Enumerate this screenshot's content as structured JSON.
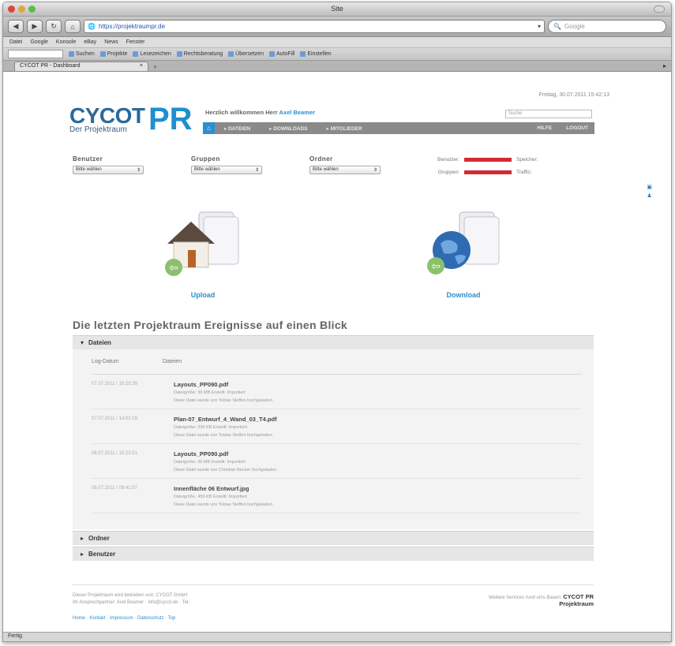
{
  "window": {
    "title": "Site"
  },
  "toolbar": {
    "back": "◀",
    "forward": "▶",
    "reload": "↻",
    "home": "⌂",
    "url": "https://projektraumpr.de",
    "url_icon": "globe-icon",
    "search_placeholder": "Google"
  },
  "menubar": {
    "items": [
      "Datei",
      "Google",
      "Konsole",
      "eBay",
      "News",
      "Fenster"
    ]
  },
  "bookmarks": {
    "items": [
      "Suchen",
      "Projekte",
      "Lesezeichen",
      "Rechtsberatung",
      "Übersetzen",
      "AutoFill",
      "Einstellen"
    ]
  },
  "tab": {
    "label": "CYCOT PR - Dashboard",
    "close": "×",
    "new": "+"
  },
  "status": {
    "text": "Fertig"
  },
  "header": {
    "datetime": "Freitag, 30.07.2011 15:42:13",
    "logo_cycot": "CYCOT",
    "logo_pr": "PR",
    "logo_sub": "Der Projektraum",
    "greeting_prefix": "Herzlich willkommen Herr",
    "greeting_user": "Axel Beamer",
    "search_placeholder": "Suche"
  },
  "nav": {
    "home_icon": "⌂",
    "items": [
      "▸ DATEIEN",
      "▸ DOWNLOADS",
      "▸ MITGLIEDER"
    ],
    "right": [
      "HILFE",
      "LOGOUT"
    ]
  },
  "filters": [
    {
      "label": "Benutzer",
      "value": "Bitte wählen"
    },
    {
      "label": "Gruppen",
      "value": "Bitte wählen"
    },
    {
      "label": "Ordner",
      "value": "Bitte wählen"
    }
  ],
  "stats": {
    "left": [
      "Benutzer:",
      "Gruppen:"
    ],
    "right": [
      "Speicher:",
      "Traffic:"
    ],
    "bar_color": "#d42a35"
  },
  "actions": {
    "upload": {
      "label": "Upload",
      "icon": "house-folder-upload-icon"
    },
    "download": {
      "label": "Download",
      "icon": "globe-folder-download-icon"
    }
  },
  "main": {
    "heading": "Die letzten Projektraum Ereignisse auf einen Blick",
    "panels": {
      "dateien": "Dateien",
      "ordner": "Ordner",
      "benutzer": "Benutzer"
    },
    "table_headers": [
      "Log-Datum",
      "Dateien"
    ],
    "rows": [
      {
        "ts": "07.07.2011 / 15:25:39",
        "file": "Layouts_PP090.pdf",
        "meta1": "Dateigröße: 36 MB  Erstellt: Importiert",
        "meta2": "Diese Datei wurde von Tobias Steffen hochgeladen."
      },
      {
        "ts": "07.07.2011 / 14:02:19",
        "file": "Plan-07_Entwurf_4_Wand_03_T4.pdf",
        "meta1": "Dateigröße: 200 KB  Erstellt: Importiert",
        "meta2": "Diese Datei wurde von Tobias Steffen hochgeladen."
      },
      {
        "ts": "06.07.2011 / 10:22:51",
        "file": "Layouts_PP090.pdf",
        "meta1": "Dateigröße: 36 MB  Erstellt: Importiert",
        "meta2": "Diese Datei wurde von Christian Becker hochgeladen."
      },
      {
        "ts": "05.07.2011 / 09:41:07",
        "file": "Innenfläche 06 Entwurf.jpg",
        "meta1": "Dateigröße: 455 KB  Erstellt: Importiert",
        "meta2": "Diese Datei wurde von Tobias Steffen hochgeladen."
      }
    ]
  },
  "footer": {
    "line1": "Dieser Projektraum wird betrieben von: CYCOT GmbH",
    "line2": "Ihr Ansprechpartner: Axel Beamer · info@cycot.de · Tel.",
    "links": "Home · Kontakt · Impressum · Datenschutz · Top",
    "right_text": "Weitere Services rund ums Bauen:",
    "right_brand": "CYCOT PR",
    "right_brand2": "Projektraum"
  }
}
